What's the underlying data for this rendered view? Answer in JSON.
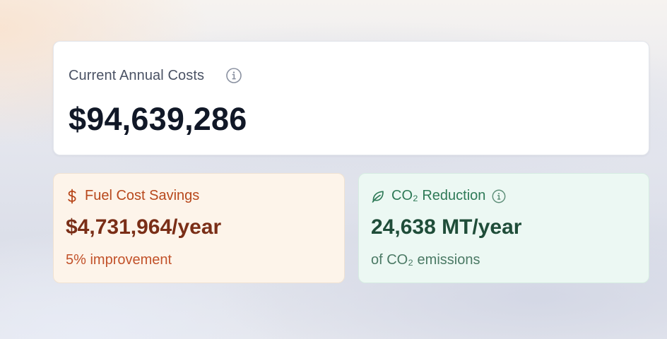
{
  "current_costs": {
    "title": "Current Annual Costs",
    "value": "$94,639,286",
    "info_icon": "info-icon"
  },
  "fuel_savings": {
    "icon": "dollar-icon",
    "title": "Fuel Cost Savings",
    "value": "$4,731,964/year",
    "subtitle": "5% improvement"
  },
  "co2_reduction": {
    "icon": "leaf-icon",
    "title": "CO₂ Reduction",
    "info_icon": "info-icon",
    "value": "24,638 MT/year",
    "subtitle": "of CO₂ emissions"
  },
  "colors": {
    "costs_value": "#111827",
    "fuel_accent": "#b8481c",
    "fuel_value": "#7a2e17",
    "fuel_background": "#fdf4ea",
    "co2_accent": "#2e7a57",
    "co2_value": "#1f4d39",
    "co2_background": "#ecf8f3"
  }
}
